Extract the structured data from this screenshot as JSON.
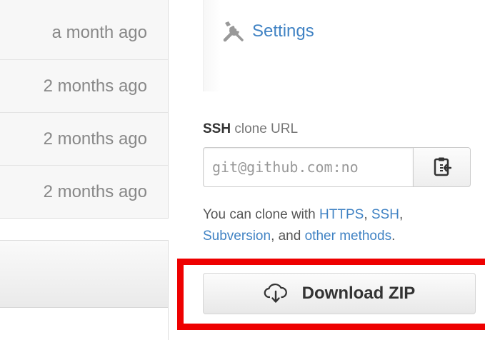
{
  "file_list": {
    "rows": [
      {
        "age": "a month ago"
      },
      {
        "age": "2 months ago"
      },
      {
        "age": "2 months ago"
      },
      {
        "age": "2 months ago"
      }
    ]
  },
  "sidebar": {
    "settings_label": "Settings"
  },
  "clone": {
    "protocol": "SSH",
    "title_suffix": " clone URL",
    "url_value": "git@github.com:no",
    "help_prefix": "You can clone with ",
    "link_https": "HTTPS",
    "sep_1": ", ",
    "link_ssh": "SSH",
    "sep_2": ",",
    "link_subversion": "Subversion",
    "sep_3": ", and ",
    "link_other": "other methods",
    "help_suffix": "."
  },
  "download": {
    "label": "Download ZIP"
  },
  "colors": {
    "link": "#4183c4",
    "highlight": "#ee0000"
  },
  "icons": {
    "settings": "tools-icon",
    "clipboard": "clipboard-icon",
    "download": "cloud-download-icon"
  }
}
